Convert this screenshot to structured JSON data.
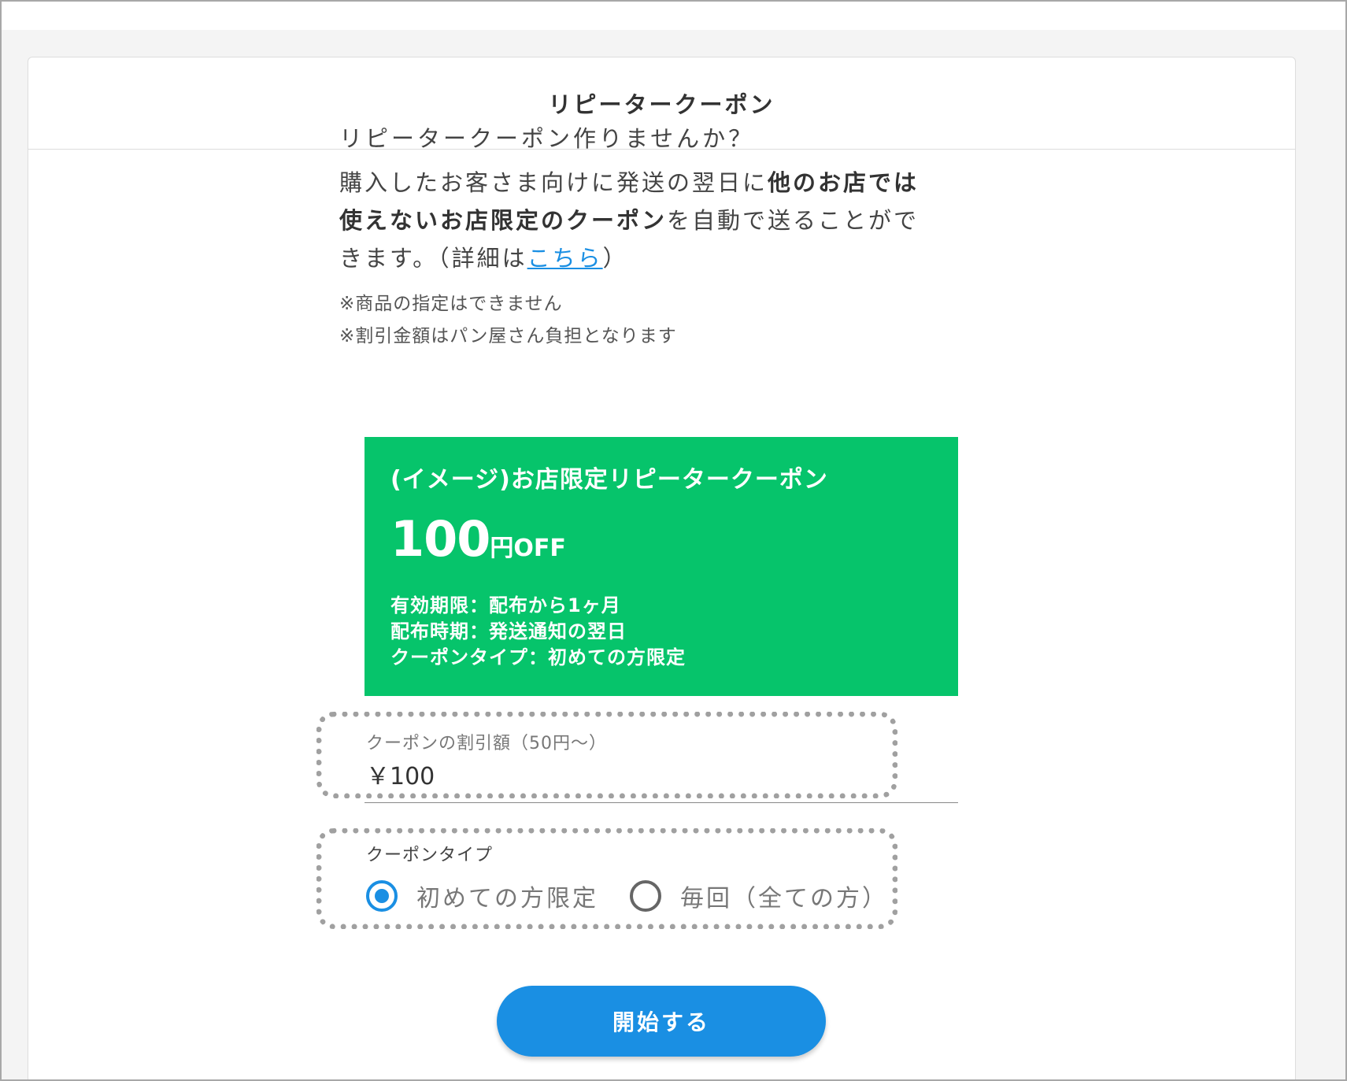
{
  "card": {
    "title": "リピータークーポン"
  },
  "intro": {
    "question": "リピータークーポン作りませんか？",
    "desc_part1": "購入したお客さま向けに発送の翌日に",
    "desc_bold1": "他のお店では使えないお店限定のクーポン",
    "desc_part2": "を自動で送ることができます。（詳細は",
    "desc_link": "こちら",
    "desc_part3": "）",
    "note1": "※商品の指定はできません",
    "note2": "※割引金額はパン屋さん負担となります"
  },
  "coupon_preview": {
    "title": "(イメージ)お店限定リピータークーポン",
    "amount": "100",
    "amount_unit": "円OFF",
    "line1": "有効期限：配布から1ヶ月",
    "line2": "配布時期：発送通知の翌日",
    "line3": "クーポンタイプ：初めての方限定",
    "background_color": "#06c46b"
  },
  "discount_field": {
    "label": "クーポンの割引額（50円〜）",
    "value": "￥100"
  },
  "coupon_type": {
    "label": "クーポンタイプ",
    "options": [
      {
        "label": "初めての方限定",
        "checked": true
      },
      {
        "label": "毎回（全ての方）",
        "checked": false
      }
    ]
  },
  "start_button": {
    "label": "開始する",
    "color": "#1a8fe3"
  }
}
